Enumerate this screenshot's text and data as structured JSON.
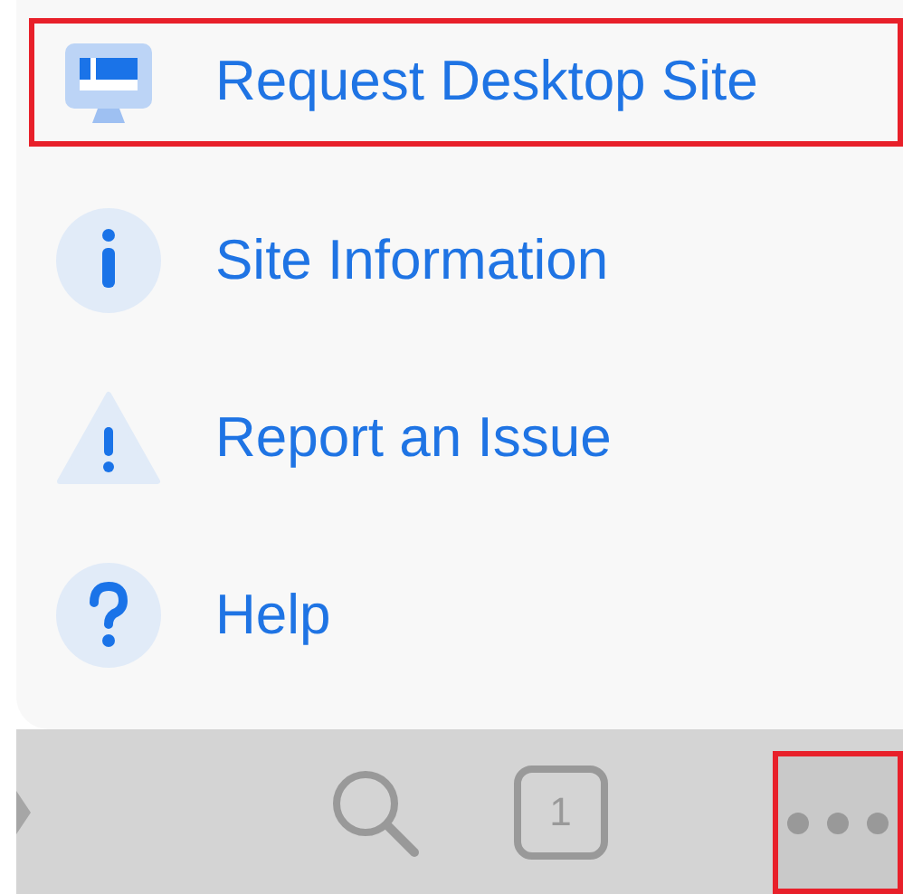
{
  "menu": {
    "items": [
      {
        "kind": "desktop",
        "label": "Request Desktop Site",
        "highlighted": true
      },
      {
        "kind": "info",
        "label": "Site Information",
        "highlighted": false
      },
      {
        "kind": "warning",
        "label": "Report an Issue",
        "highlighted": false
      },
      {
        "kind": "help",
        "label": "Help",
        "highlighted": false
      }
    ]
  },
  "toolbar": {
    "tab_count": "1",
    "buttons": [
      {
        "kind": "forward",
        "highlighted": false
      },
      {
        "kind": "search",
        "highlighted": false
      },
      {
        "kind": "tabs",
        "highlighted": false
      },
      {
        "kind": "more",
        "highlighted": true
      }
    ]
  }
}
